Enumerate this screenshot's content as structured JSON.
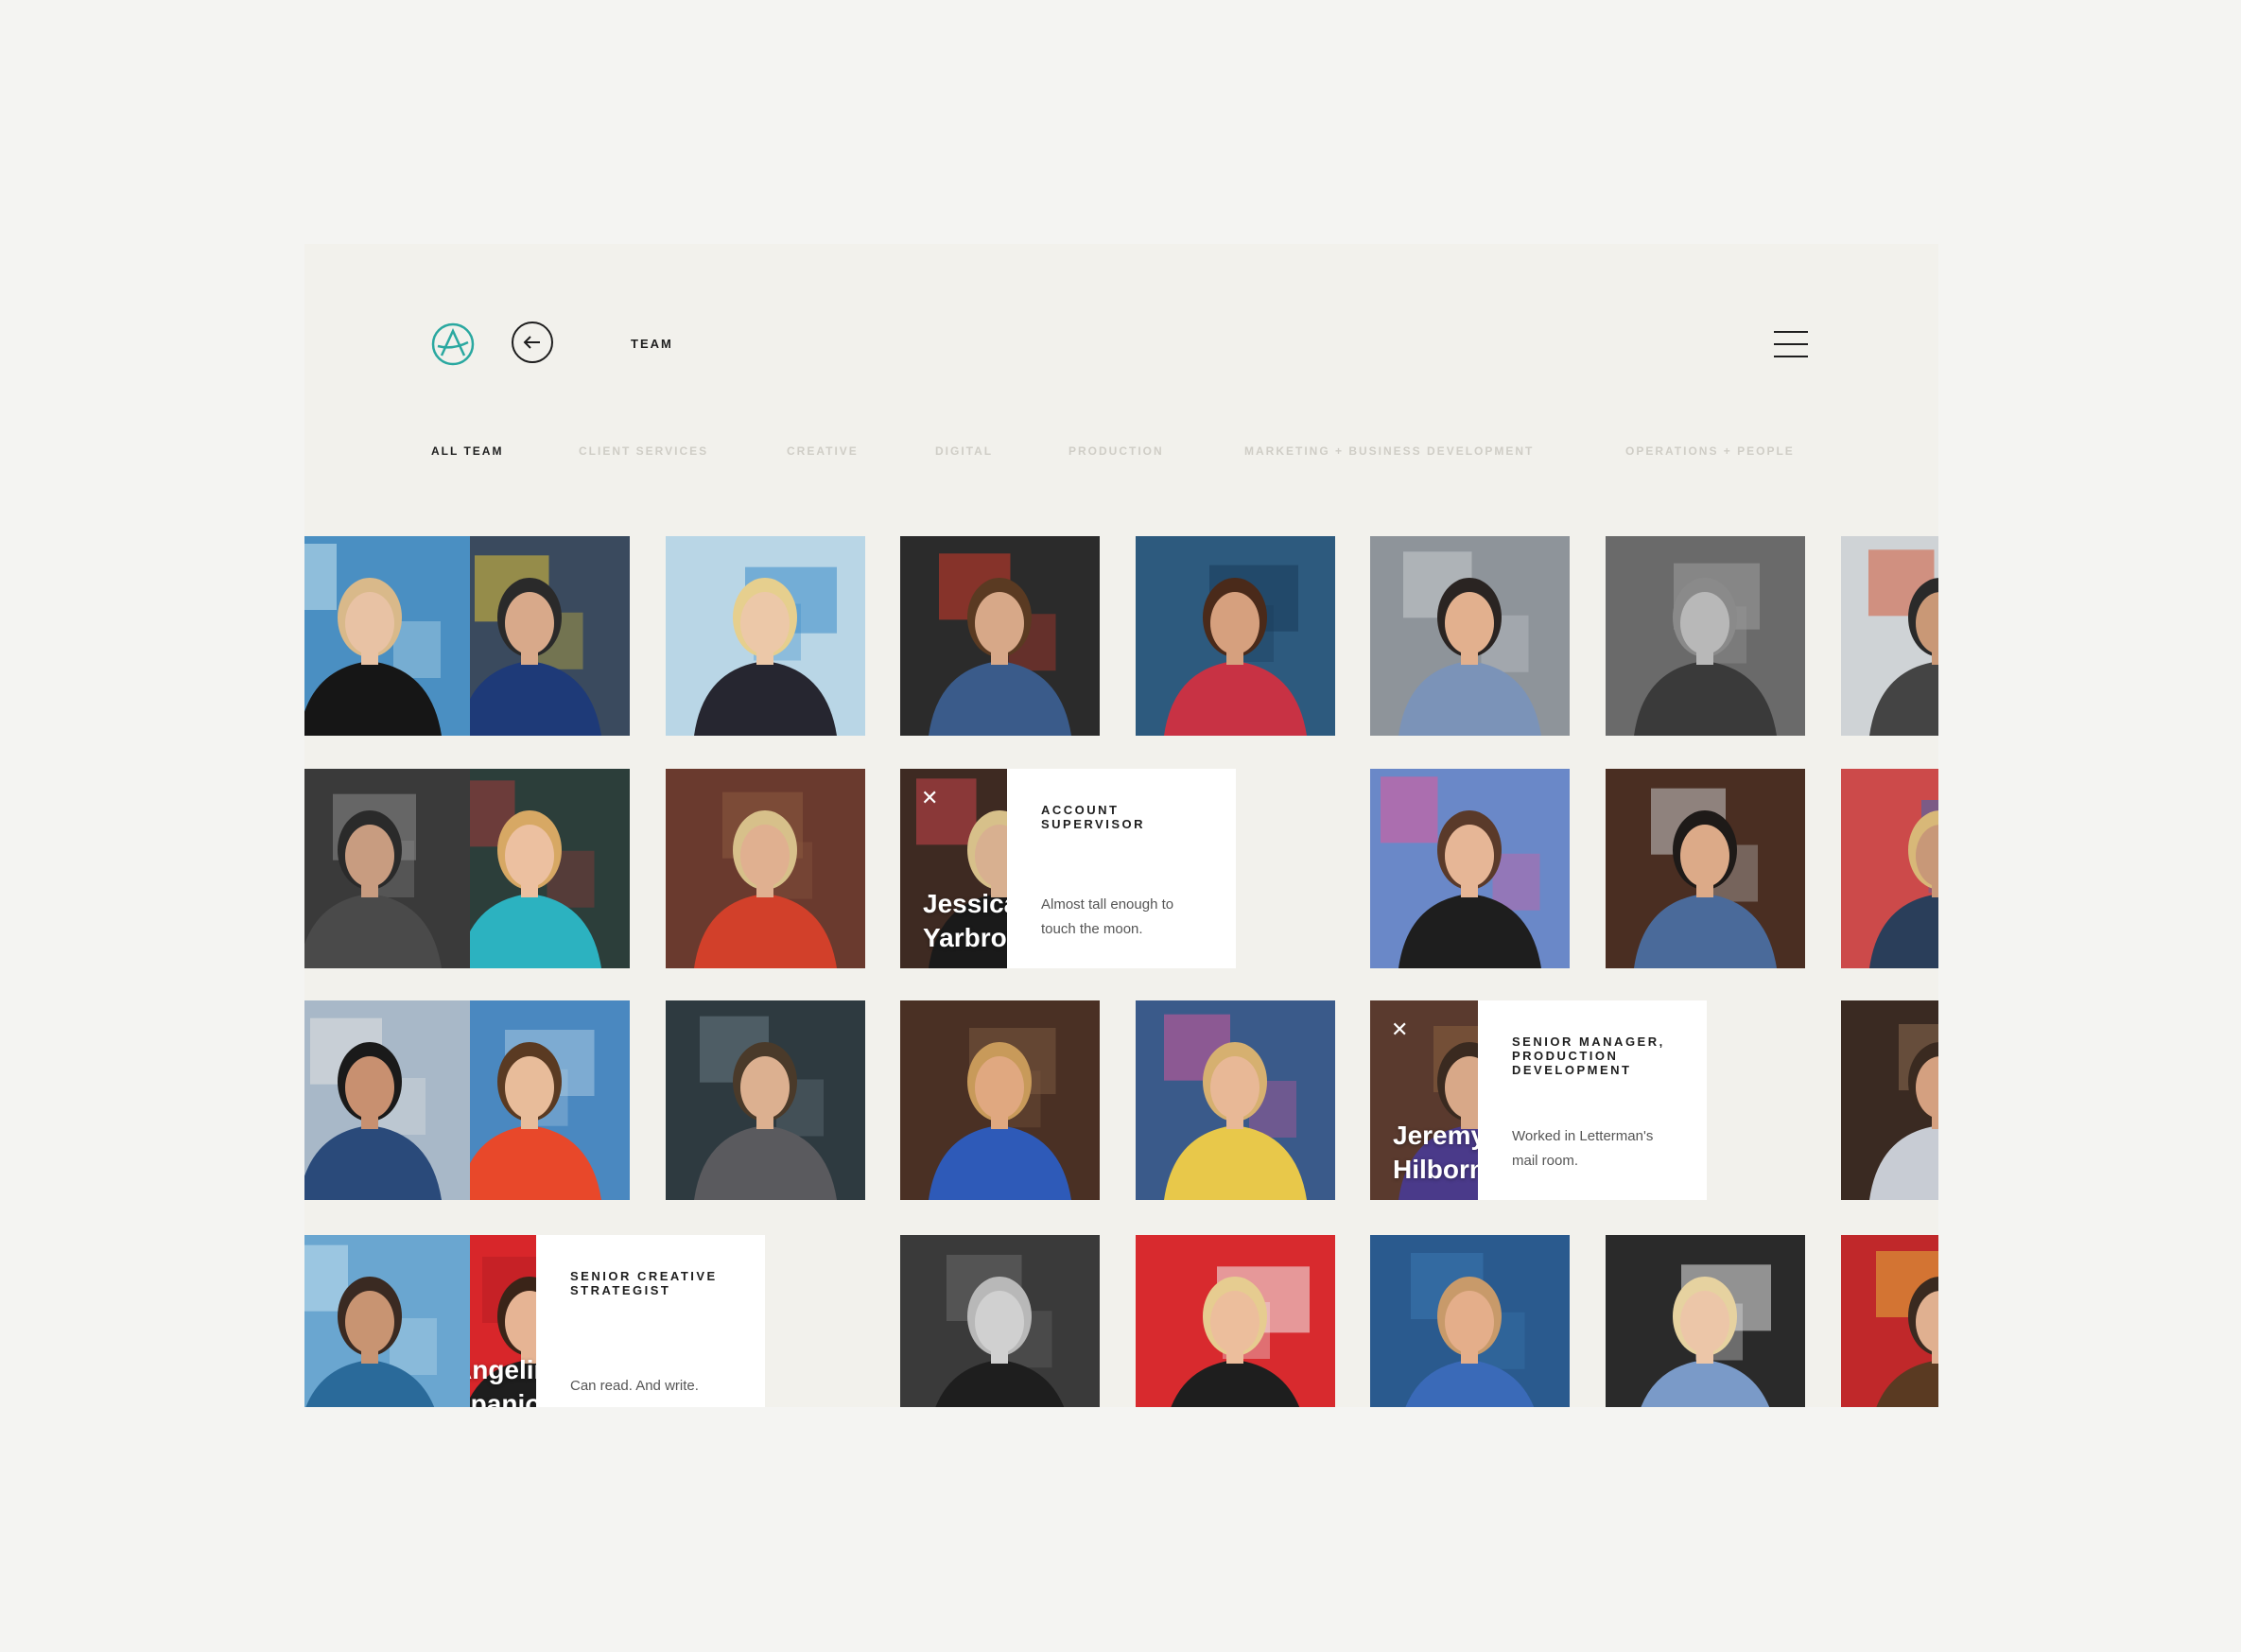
{
  "header": {
    "title": "TEAM"
  },
  "filters": [
    {
      "label": "ALL TEAM"
    },
    {
      "label": "CLIENT SERVICES"
    },
    {
      "label": "CREATIVE"
    },
    {
      "label": "DIGITAL"
    },
    {
      "label": "PRODUCTION"
    },
    {
      "label": "MARKETING + BUSINESS DEVELOPMENT"
    },
    {
      "label": "OPERATIONS + PEOPLE"
    }
  ],
  "active_filter": "ALL TEAM",
  "expanded_members": [
    {
      "name_line1": "Jessica",
      "name_line2": "Yarbrough",
      "title": "ACCOUNT SUPERVISOR",
      "desc_line1": "Almost tall enough to",
      "desc_line2": "touch the moon."
    },
    {
      "name_line1": "Jeremy",
      "name_line2": "Hilborn",
      "title": "SENIOR MANAGER, PRODUCTION DEVELOPMENT",
      "desc_line1": "Worked in Letterman's",
      "desc_line2": "mail room."
    },
    {
      "name_line1": "Angelina",
      "name_line2": "Spaniolo",
      "title": "SENIOR CREATIVE STRATEGIST",
      "desc_line1": "Can read. And write.",
      "desc_line2": ""
    }
  ],
  "colors": {
    "accent": "#2aa8a0",
    "background": "#f2f1ec",
    "text": "#1e1e1e",
    "muted": "#cfcdc6"
  }
}
